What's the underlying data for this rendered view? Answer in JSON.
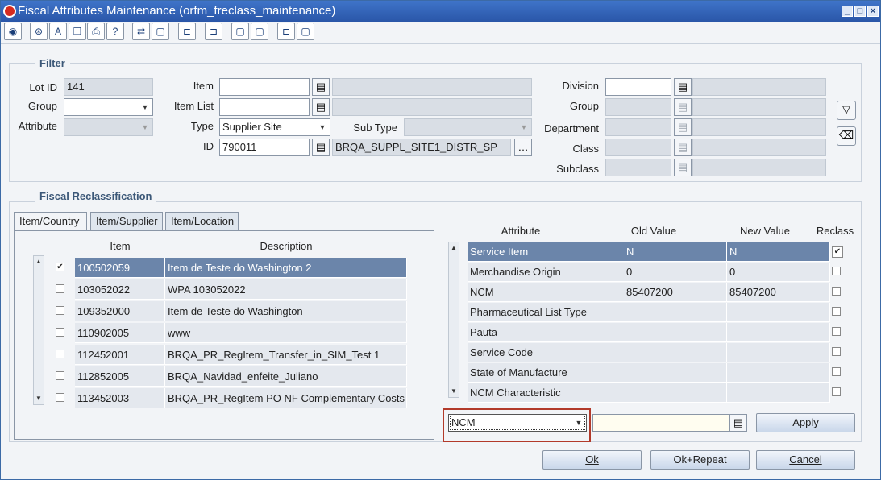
{
  "window": {
    "title": "Fiscal Attributes Maintenance  (orfm_freclass_maintenance)"
  },
  "toolbar": {
    "icons": [
      "globe-icon",
      "help-icon",
      "spell-icon",
      "copy-icon",
      "print-icon",
      "question-icon",
      "export-icon",
      "new-icon",
      "tree-left-icon",
      "tree-right-icon",
      "doc-icon",
      "doc2-icon",
      "tree3-icon",
      "doc3-icon"
    ]
  },
  "filter": {
    "title": "Filter",
    "lot_id_label": "Lot ID",
    "lot_id_value": "141",
    "group_label": "Group",
    "attribute_label": "Attribute",
    "item_label": "Item",
    "item_list_label": "Item List",
    "type_label": "Type",
    "type_value": "Supplier Site",
    "sub_type_label": "Sub Type",
    "id_label": "ID",
    "id_value": "790011",
    "id_desc": "BRQA_SUPPL_SITE1_DISTR_SP",
    "division_label": "Division",
    "group2_label": "Group",
    "department_label": "Department",
    "class_label": "Class",
    "subclass_label": "Subclass"
  },
  "reclass": {
    "title": "Fiscal Reclassification",
    "tabs": [
      "Item/Country",
      "Item/Supplier",
      "Item/Location"
    ],
    "item_header": "Item",
    "desc_header": "Description",
    "rows": [
      {
        "item": "100502059",
        "desc": "Item de Teste do Washington 2",
        "checked": "✔"
      },
      {
        "item": "103052022",
        "desc": "WPA 103052022",
        "checked": ""
      },
      {
        "item": "109352000",
        "desc": "Item de Teste do Washington",
        "checked": ""
      },
      {
        "item": "110902005",
        "desc": "www",
        "checked": ""
      },
      {
        "item": "112452001",
        "desc": "BRQA_PR_RegItem_Transfer_in_SIM_Test 1",
        "checked": ""
      },
      {
        "item": "112852005",
        "desc": "BRQA_Navidad_enfeite_Juliano",
        "checked": ""
      },
      {
        "item": "113452003",
        "desc": "BRQA_PR_RegItem PO NF Complementary Costs",
        "checked": ""
      }
    ],
    "attr_header": "Attribute",
    "old_header": "Old Value",
    "new_header": "New Value",
    "reclass_header": "Reclass",
    "attrs": [
      {
        "name": "Service Item",
        "old": "N",
        "new": "N",
        "reclass": "✔"
      },
      {
        "name": "Merchandise Origin",
        "old": "0",
        "new": "0",
        "reclass": ""
      },
      {
        "name": "NCM",
        "old": "85407200",
        "new": "85407200",
        "reclass": ""
      },
      {
        "name": "Pharmaceutical List Type",
        "old": "",
        "new": "",
        "reclass": ""
      },
      {
        "name": "Pauta",
        "old": "",
        "new": "",
        "reclass": ""
      },
      {
        "name": "Service Code",
        "old": "",
        "new": "",
        "reclass": ""
      },
      {
        "name": "State of Manufacture",
        "old": "",
        "new": "",
        "reclass": ""
      },
      {
        "name": "NCM Characteristic",
        "old": "",
        "new": "",
        "reclass": ""
      }
    ],
    "attr_select": "NCM",
    "apply_label": "Apply"
  },
  "footer": {
    "ok": "Ok",
    "ok_repeat": "Ok+Repeat",
    "cancel": "Cancel"
  },
  "colors": {
    "title_bar": "#2f62b8",
    "selected_row": "#6b85aa",
    "highlight_border": "#b23a2a"
  }
}
